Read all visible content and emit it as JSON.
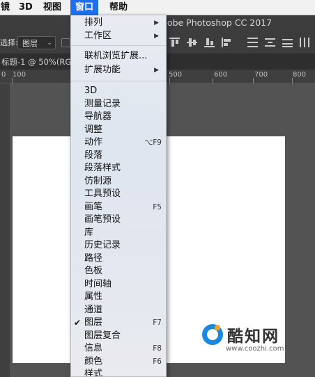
{
  "menubar": {
    "items": [
      {
        "label": "镜"
      },
      {
        "label": "3D"
      },
      {
        "label": "视图"
      },
      {
        "label": "窗口",
        "active": true
      },
      {
        "label": "帮助"
      }
    ]
  },
  "app_title": "dobe Photoshop CC 2017",
  "options": {
    "select_label": "选择:",
    "select_value": "图层"
  },
  "document_tab": "标题-1 @ 50%(RGB",
  "ruler": [
    "0",
    "100",
    "500",
    "600",
    "700",
    "800"
  ],
  "window_menu": {
    "group1": [
      {
        "label": "排列",
        "submenu": true
      },
      {
        "label": "工作区",
        "submenu": true
      }
    ],
    "group2": [
      {
        "label": "联机浏览扩展..."
      },
      {
        "label": "扩展功能",
        "submenu": true
      }
    ],
    "group3": [
      {
        "label": "3D"
      },
      {
        "label": "测量记录"
      },
      {
        "label": "导航器"
      },
      {
        "label": "调整"
      },
      {
        "label": "动作",
        "shortcut": "⌥F9"
      },
      {
        "label": "段落"
      },
      {
        "label": "段落样式"
      },
      {
        "label": "仿制源"
      },
      {
        "label": "工具预设"
      },
      {
        "label": "画笔",
        "shortcut": "F5"
      },
      {
        "label": "画笔预设"
      },
      {
        "label": "库"
      },
      {
        "label": "历史记录"
      },
      {
        "label": "路径"
      },
      {
        "label": "色板"
      },
      {
        "label": "时间轴"
      },
      {
        "label": "属性"
      },
      {
        "label": "通道"
      },
      {
        "label": "图层",
        "shortcut": "F7",
        "checked": true
      },
      {
        "label": "图层复合"
      },
      {
        "label": "信息",
        "shortcut": "F8"
      },
      {
        "label": "颜色",
        "shortcut": "F6"
      },
      {
        "label": "样式"
      }
    ]
  },
  "watermark": {
    "text": "酷知网",
    "url": "www.coozhi.com"
  },
  "colors": {
    "menu_highlight": "#1e6ff0",
    "workspace": "#535353",
    "watermark_blue": "#1a88e0",
    "watermark_orange": "#f3a51b"
  }
}
